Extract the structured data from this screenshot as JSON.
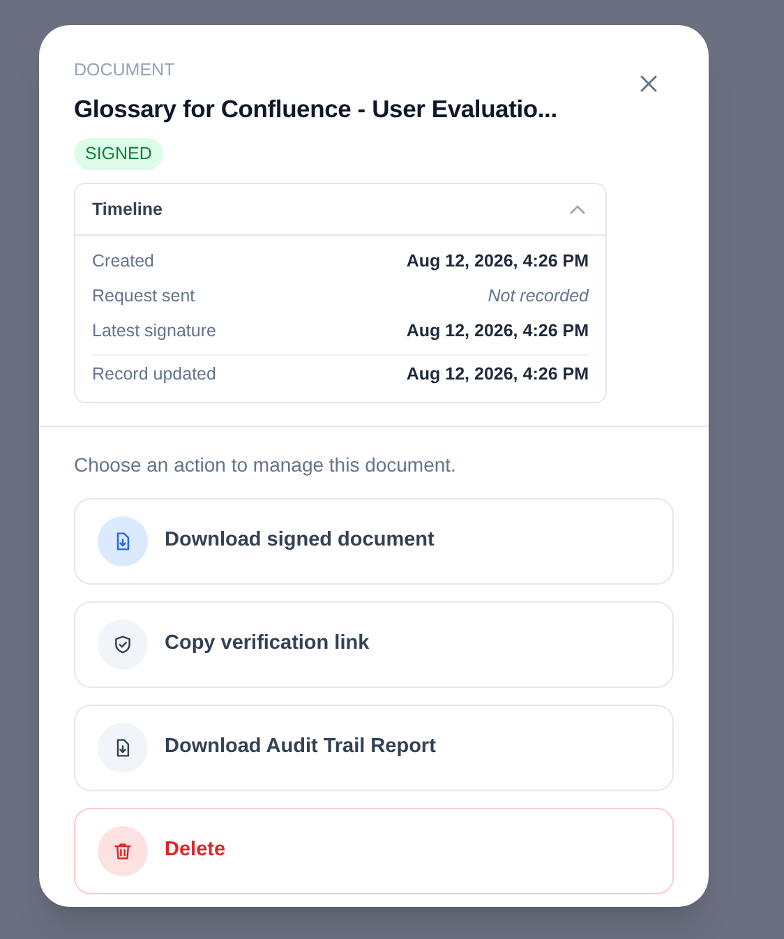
{
  "dialog": {
    "eyebrow": "DOCUMENT",
    "title": "Glossary for Confluence - User Evaluatio...",
    "status": {
      "label": "SIGNED",
      "kind": "success"
    },
    "timeline": {
      "title": "Timeline",
      "expanded": true,
      "rows": [
        {
          "label": "Created",
          "value": "Aug 12, 2026, 4:26 PM",
          "recorded": true,
          "divider_before": false
        },
        {
          "label": "Request sent",
          "value": "Not recorded",
          "recorded": false,
          "divider_before": false
        },
        {
          "label": "Latest signature",
          "value": "Aug 12, 2026, 4:26 PM",
          "recorded": true,
          "divider_before": false
        },
        {
          "label": "Record updated",
          "value": "Aug 12, 2026, 4:26 PM",
          "recorded": true,
          "divider_before": true
        }
      ]
    },
    "prompt": "Choose an action to manage this document.",
    "actions": [
      {
        "label": "Download signed document",
        "kind": "primary"
      },
      {
        "label": "Copy verification link",
        "kind": "neutral"
      },
      {
        "label": "Download Audit Trail Report",
        "kind": "neutral"
      },
      {
        "label": "Delete",
        "kind": "danger"
      }
    ]
  }
}
